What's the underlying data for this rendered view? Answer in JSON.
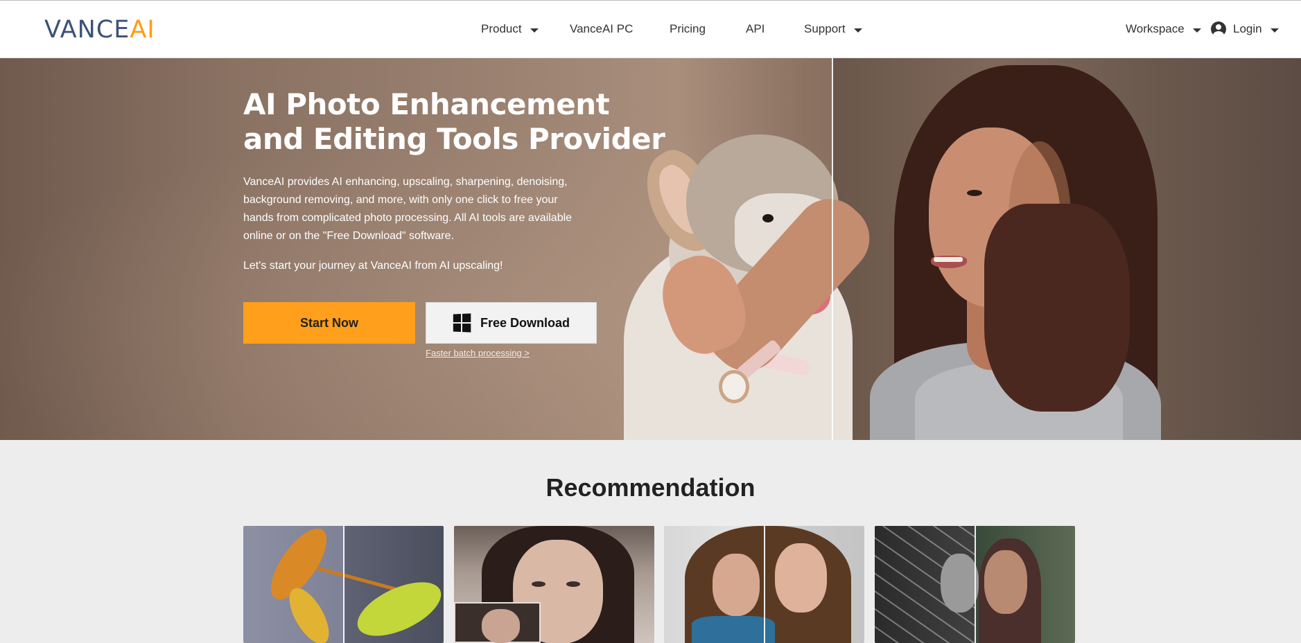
{
  "header": {
    "logo": {
      "part1": "VANCE",
      "part2": "AI"
    },
    "nav": [
      {
        "label": "Product",
        "has_dropdown": true
      },
      {
        "label": "VanceAI PC",
        "has_dropdown": false
      },
      {
        "label": "Pricing",
        "has_dropdown": false
      },
      {
        "label": "API",
        "has_dropdown": false
      },
      {
        "label": "Support",
        "has_dropdown": true
      }
    ],
    "workspace": {
      "label": "Workspace",
      "has_dropdown": true
    },
    "login": {
      "label": "Login",
      "icon": "user-circle-icon",
      "has_dropdown": true
    }
  },
  "hero": {
    "title": "AI Photo Enhancement and Editing Tools Provider",
    "description": "VanceAI provides AI enhancing, upscaling, sharpening, denoising, background removing, and more, with only one click to free your hands from complicated photo processing. All AI tools are available online or on the \"Free Download\" software.",
    "cta_text": "Let's start your journey at VanceAI from AI upscaling!",
    "start_button": "Start Now",
    "download_button": "Free Download",
    "download_icon": "windows-icon",
    "batch_link": "Faster batch processing >"
  },
  "recommendation": {
    "title": "Recommendation"
  },
  "colors": {
    "brand_blue": "#3b5178",
    "brand_orange": "#ff9b16",
    "start_button": "#ff9f1c",
    "page_bg": "#ededed"
  }
}
